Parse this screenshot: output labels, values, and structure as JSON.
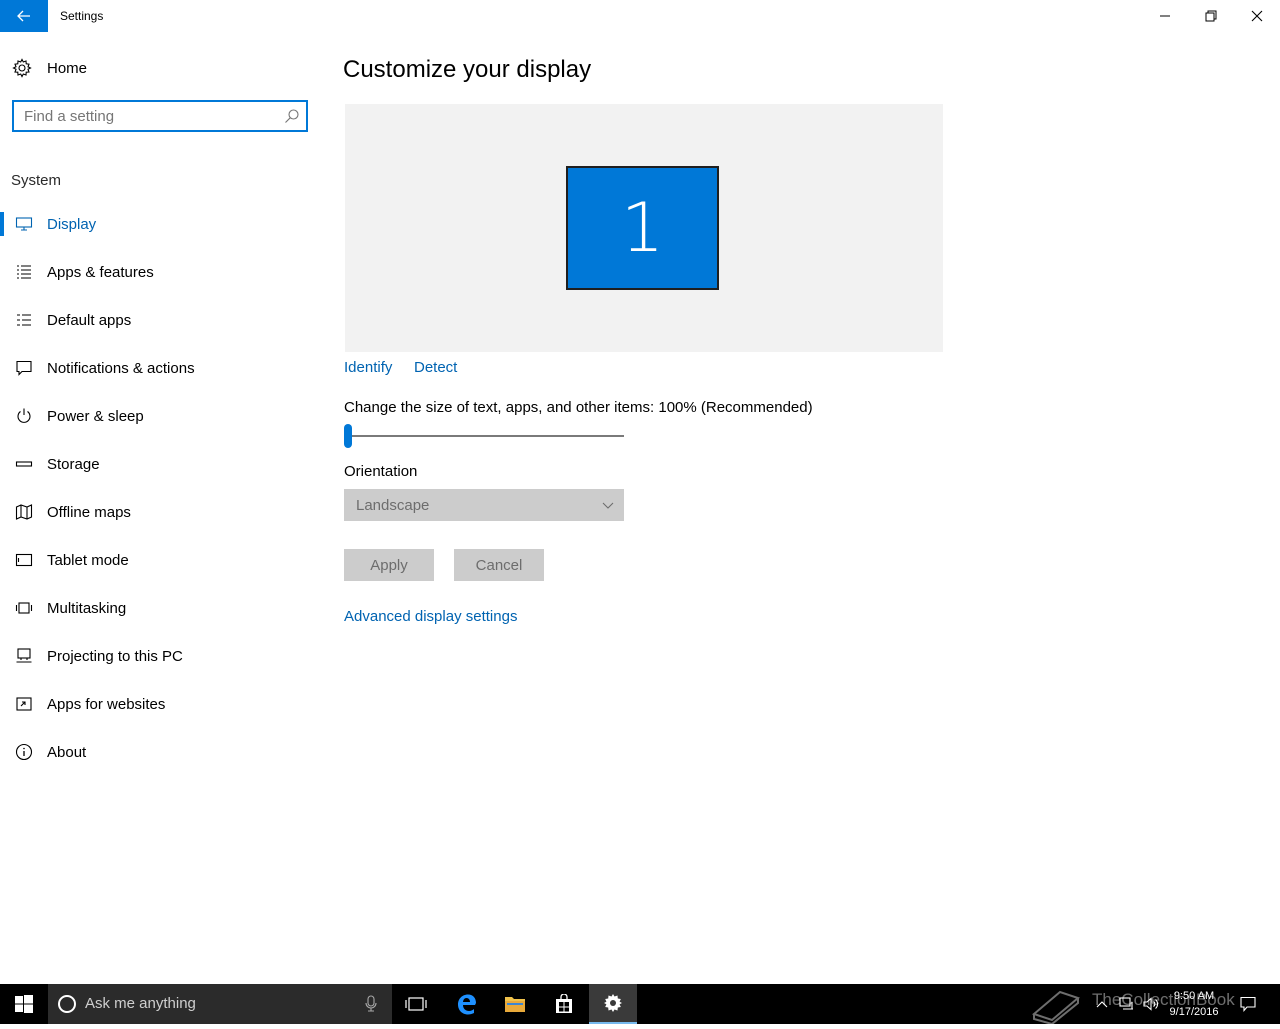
{
  "window": {
    "title": "Settings"
  },
  "sidebar": {
    "home_label": "Home",
    "search_placeholder": "Find a setting",
    "section_title": "System",
    "items": [
      {
        "label": "Display",
        "icon": "monitor-icon",
        "selected": true
      },
      {
        "label": "Apps & features",
        "icon": "list-icon"
      },
      {
        "label": "Default apps",
        "icon": "default-apps-icon"
      },
      {
        "label": "Notifications & actions",
        "icon": "message-icon"
      },
      {
        "label": "Power & sleep",
        "icon": "power-icon"
      },
      {
        "label": "Storage",
        "icon": "storage-icon"
      },
      {
        "label": "Offline maps",
        "icon": "map-icon"
      },
      {
        "label": "Tablet mode",
        "icon": "tablet-icon"
      },
      {
        "label": "Multitasking",
        "icon": "multitasking-icon"
      },
      {
        "label": "Projecting to this PC",
        "icon": "projecting-icon"
      },
      {
        "label": "Apps for websites",
        "icon": "apps-websites-icon"
      },
      {
        "label": "About",
        "icon": "info-icon"
      }
    ]
  },
  "main": {
    "title": "Customize your display",
    "monitor_number": "1",
    "identify_label": "Identify",
    "detect_label": "Detect",
    "scale_label": "Change the size of text, apps, and other items: 100% (Recommended)",
    "scale_slider_fraction": 0,
    "orientation_label": "Orientation",
    "orientation_value": "Landscape",
    "apply_label": "Apply",
    "cancel_label": "Cancel",
    "advanced_link": "Advanced display settings"
  },
  "taskbar": {
    "search_placeholder": "Ask me anything",
    "time": "9:50 AM",
    "date": "9/17/2016",
    "watermark": "TheCollectionBook"
  },
  "colors": {
    "accent": "#0078d7",
    "link": "#0063b1",
    "disabled_bg": "#cccccc"
  }
}
